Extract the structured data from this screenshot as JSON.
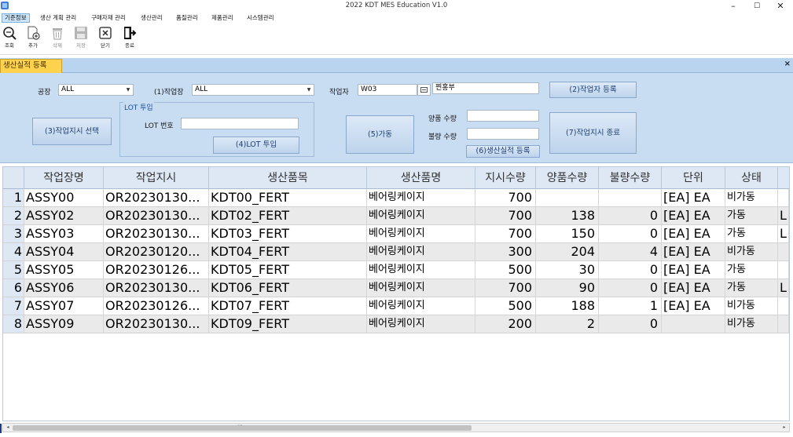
{
  "window": {
    "title": "2022 KDT MES Education V1.0",
    "minimize": "–",
    "maximize": "☐",
    "close": "✕"
  },
  "menu": {
    "items": [
      "기준정보",
      "생산 계획 관리",
      "구매자재 관리",
      "생산관리",
      "품질관리",
      "제품관리",
      "시스템관리"
    ],
    "active_index": 0
  },
  "toolbar": {
    "items": [
      {
        "label": "조회",
        "icon": "search-icon",
        "enabled": true
      },
      {
        "label": "추가",
        "icon": "add-document-icon",
        "enabled": true
      },
      {
        "label": "삭제",
        "icon": "trash-icon",
        "enabled": false
      },
      {
        "label": "저장",
        "icon": "floppy-disk-icon",
        "enabled": false
      },
      {
        "label": "닫기",
        "icon": "close-box-icon",
        "enabled": true
      },
      {
        "label": "종료",
        "icon": "exit-door-icon",
        "enabled": true
      }
    ]
  },
  "tab": {
    "label": "생산실적 등록",
    "close": "×"
  },
  "form": {
    "plant_label": "공장",
    "plant_value": "ALL",
    "workcenter_label": "(1)작업장",
    "workcenter_value": "ALL",
    "worker_label": "작업자",
    "worker_code": "W03",
    "worker_name": "찐홍부",
    "register_worker_button": "(2)작업자 등록",
    "select_order_button": "(3)작업지시 선택",
    "lot_group_caption": "LOT 투입",
    "lot_no_label": "LOT 번호",
    "lot_no_value": "",
    "lot_input_button": "(4)LOT 투입",
    "operate_button": "(5)가동",
    "good_qty_label": "양품 수량",
    "good_qty_value": "",
    "bad_qty_label": "불량 수량",
    "bad_qty_value": "",
    "register_result_button": "(6)생산실적 등록",
    "finish_order_button": "(7)작업지시 종료"
  },
  "colors": {
    "panel_bg": "#c8dcf2",
    "tab_bg": "#ffd24d",
    "grid_header_bg": "#dde8f4",
    "alt_row_bg": "#eaeaea"
  },
  "table": {
    "columns": [
      "작업장명",
      "작업지시",
      "생산품목",
      "생산품명",
      "지시수량",
      "양품수량",
      "불량수량",
      "단위",
      "상태"
    ],
    "rows": [
      {
        "no": "1",
        "workcenter": "ASSY00",
        "order": "OR20230130...",
        "item": "KDT00_FERT",
        "item_name": "베어링케이지",
        "order_qty": "700",
        "good_qty": "",
        "bad_qty": "",
        "unit": "[EA] EA",
        "status": "비가동",
        "extra": ""
      },
      {
        "no": "2",
        "workcenter": "ASSY02",
        "order": "OR20230130...",
        "item": "KDT02_FERT",
        "item_name": "베어링케이지",
        "order_qty": "700",
        "good_qty": "138",
        "bad_qty": "0",
        "unit": "[EA] EA",
        "status": "가동",
        "extra": "L"
      },
      {
        "no": "3",
        "workcenter": "ASSY03",
        "order": "OR20230130...",
        "item": "KDT03_FERT",
        "item_name": "베어링케이지",
        "order_qty": "700",
        "good_qty": "150",
        "bad_qty": "0",
        "unit": "[EA] EA",
        "status": "가동",
        "extra": "L"
      },
      {
        "no": "4",
        "workcenter": "ASSY04",
        "order": "OR20230120...",
        "item": "KDT04_FERT",
        "item_name": "베어링케이지",
        "order_qty": "300",
        "good_qty": "204",
        "bad_qty": "4",
        "unit": "[EA] EA",
        "status": "비가동",
        "extra": ""
      },
      {
        "no": "5",
        "workcenter": "ASSY05",
        "order": "OR20230126...",
        "item": "KDT05_FERT",
        "item_name": "베어링케이지",
        "order_qty": "500",
        "good_qty": "30",
        "bad_qty": "0",
        "unit": "[EA] EA",
        "status": "가동",
        "extra": ""
      },
      {
        "no": "6",
        "workcenter": "ASSY06",
        "order": "OR20230130...",
        "item": "KDT06_FERT",
        "item_name": "베어링케이지",
        "order_qty": "700",
        "good_qty": "90",
        "bad_qty": "0",
        "unit": "[EA] EA",
        "status": "가동",
        "extra": "L"
      },
      {
        "no": "7",
        "workcenter": "ASSY07",
        "order": "OR20230126...",
        "item": "KDT07_FERT",
        "item_name": "베어링케이지",
        "order_qty": "500",
        "good_qty": "188",
        "bad_qty": "1",
        "unit": "[EA] EA",
        "status": "비가동",
        "extra": ""
      },
      {
        "no": "8",
        "workcenter": "ASSY09",
        "order": "OR20230130...",
        "item": "KDT09_FERT",
        "item_name": "베어링케이지",
        "order_qty": "200",
        "good_qty": "2",
        "bad_qty": "0",
        "unit": "",
        "status": "비가동",
        "extra": ""
      }
    ]
  },
  "scroll": {
    "left_arrow": "◂",
    "right_arrow": "▸",
    "thumb_grip": "⋯"
  }
}
